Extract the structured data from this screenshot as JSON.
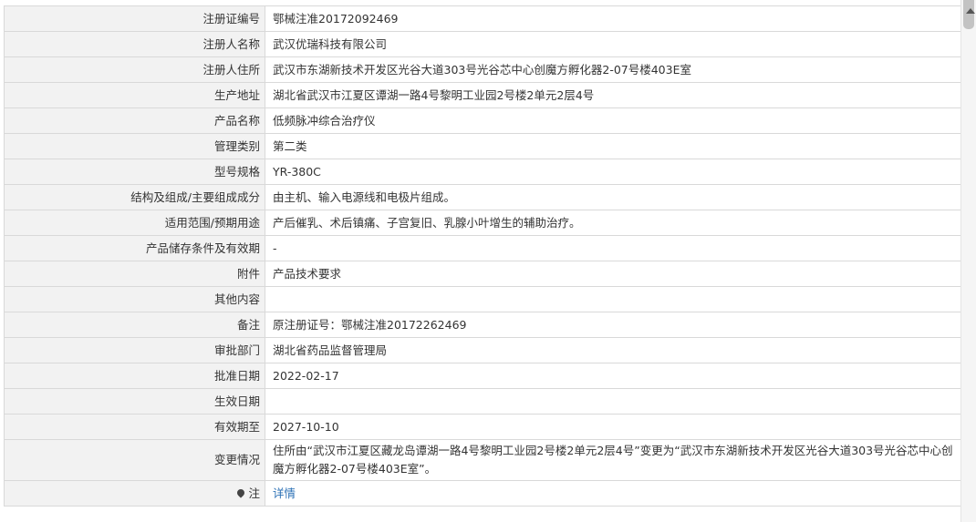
{
  "rows": [
    {
      "label": "注册证编号",
      "value": "鄂械注准20172092469"
    },
    {
      "label": "注册人名称",
      "value": "武汉优瑞科技有限公司"
    },
    {
      "label": "注册人住所",
      "value": "武汉市东湖新技术开发区光谷大道303号光谷芯中心创魔方孵化器2-07号楼403E室"
    },
    {
      "label": "生产地址",
      "value": "湖北省武汉市江夏区谭湖一路4号黎明工业园2号楼2单元2层4号"
    },
    {
      "label": "产品名称",
      "value": "低频脉冲综合治疗仪"
    },
    {
      "label": "管理类别",
      "value": "第二类"
    },
    {
      "label": "型号规格",
      "value": "YR-380C"
    },
    {
      "label": "结构及组成/主要组成成分",
      "value": "由主机、输入电源线和电极片组成。"
    },
    {
      "label": "适用范围/预期用途",
      "value": "产后催乳、术后镇痛、子宫复旧、乳腺小叶增生的辅助治疗。"
    },
    {
      "label": "产品储存条件及有效期",
      "value": "-"
    },
    {
      "label": "附件",
      "value": "产品技术要求"
    },
    {
      "label": "其他内容",
      "value": ""
    },
    {
      "label": "备注",
      "value": "原注册证号：鄂械注准20172262469"
    },
    {
      "label": "审批部门",
      "value": "湖北省药品监督管理局"
    },
    {
      "label": "批准日期",
      "value": "2022-02-17"
    },
    {
      "label": "生效日期",
      "value": ""
    },
    {
      "label": "有效期至",
      "value": "2027-10-10"
    },
    {
      "label": "变更情况",
      "value": "住所由“武汉市江夏区藏龙岛谭湖一路4号黎明工业园2号楼2单元2层4号”变更为“武汉市东湖新技术开发区光谷大道303号光谷芯中心创魔方孵化器2-07号楼403E室”。"
    }
  ],
  "note": {
    "label": "注",
    "link": "详情"
  },
  "icons": {
    "note": "map-pin-icon",
    "scroll": "scroll-up-arrow-icon"
  }
}
